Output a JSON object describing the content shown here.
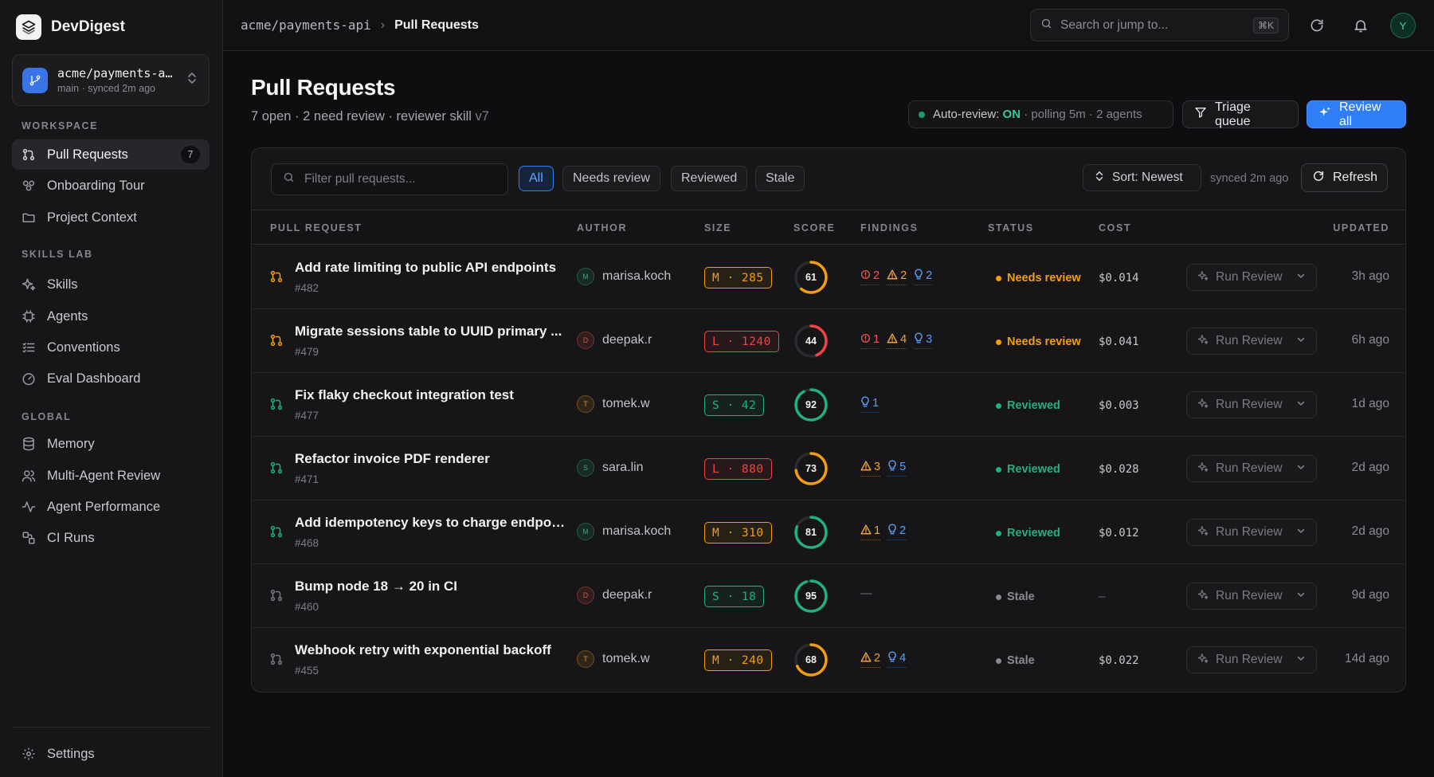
{
  "brand": {
    "name": "DevDigest"
  },
  "repo_selector": {
    "name": "acme/payments-a…",
    "sub": "main · synced 2m ago"
  },
  "sidebar": {
    "sections": [
      {
        "label": "WORKSPACE"
      },
      {
        "label": "SKILLS LAB"
      },
      {
        "label": "GLOBAL"
      }
    ],
    "items": [
      {
        "label": "Pull Requests",
        "icon": "pull-request-icon",
        "badge": "7",
        "active": true
      },
      {
        "label": "Onboarding Tour",
        "icon": "tour-icon"
      },
      {
        "label": "Project Context",
        "icon": "folder-icon"
      },
      {
        "label": "Skills",
        "icon": "sparkle-icon"
      },
      {
        "label": "Agents",
        "icon": "cpu-icon"
      },
      {
        "label": "Conventions",
        "icon": "list-check-icon"
      },
      {
        "label": "Eval Dashboard",
        "icon": "gauge-icon"
      },
      {
        "label": "Memory",
        "icon": "database-icon"
      },
      {
        "label": "Multi-Agent Review",
        "icon": "users-icon"
      },
      {
        "label": "Agent Performance",
        "icon": "activity-icon"
      },
      {
        "label": "CI Runs",
        "icon": "ci-icon"
      }
    ],
    "settings_label": "Settings"
  },
  "topbar": {
    "breadcrumb_repo": "acme/payments-api",
    "breadcrumb_sep": "›",
    "breadcrumb_current": "Pull Requests",
    "search_placeholder": "Search or jump to...",
    "search_shortcut": "⌘K",
    "avatar_initial": "Y"
  },
  "header": {
    "title": "Pull Requests",
    "subtitle": "7 open · 2 need review · reviewer skill ",
    "subtitle_version": "v7",
    "auto_review_label": "Auto-review: ",
    "auto_review_state": "ON",
    "auto_review_detail": " · polling 5m · 2 agents",
    "triage_label": "Triage queue",
    "review_all_label": "Review all"
  },
  "filters": {
    "placeholder": "Filter pull requests...",
    "chips": [
      "All",
      "Needs review",
      "Reviewed",
      "Stale"
    ],
    "active_chip": "All",
    "sort_label": "Sort: Newest",
    "synced": "synced 2m ago",
    "refresh_label": "Refresh"
  },
  "columns": [
    "PULL REQUEST",
    "AUTHOR",
    "SIZE",
    "SCORE",
    "FINDINGS",
    "STATUS",
    "COST",
    "UPDATED"
  ],
  "run_review_label": "Run Review",
  "colors": {
    "green": "#22b07d",
    "amber": "#f59e0b",
    "red": "#ef4444",
    "blue": "#5b9df6",
    "gray": "#8a8a92",
    "accent": "#2f7ef7"
  },
  "rows": [
    {
      "title": "Add rate limiting to public API endpoints",
      "number": "#482",
      "author": "marisa.koch",
      "author_initial": "M",
      "size": "M · 285",
      "size_level": "M",
      "score": 61,
      "findings": {
        "errors": "2",
        "warnings": "2",
        "suggestions": "2"
      },
      "status": "Needs review",
      "cost": "$0.014",
      "updated": "3h ago"
    },
    {
      "title": "Migrate sessions table to UUID primary ...",
      "number": "#479",
      "author": "deepak.r",
      "author_initial": "D",
      "size": "L · 1240",
      "size_level": "L",
      "score": 44,
      "findings": {
        "errors": "1",
        "warnings": "4",
        "suggestions": "3"
      },
      "status": "Needs review",
      "cost": "$0.041",
      "updated": "6h ago"
    },
    {
      "title": "Fix flaky checkout integration test",
      "number": "#477",
      "author": "tomek.w",
      "author_initial": "T",
      "size": "S · 42",
      "size_level": "S",
      "score": 92,
      "findings": {
        "suggestions": "1"
      },
      "status": "Reviewed",
      "cost": "$0.003",
      "updated": "1d ago"
    },
    {
      "title": "Refactor invoice PDF renderer",
      "number": "#471",
      "author": "sara.lin",
      "author_initial": "S",
      "size": "L · 880",
      "size_level": "L",
      "score": 73,
      "findings": {
        "warnings": "3",
        "suggestions": "5"
      },
      "status": "Reviewed",
      "cost": "$0.028",
      "updated": "2d ago"
    },
    {
      "title": "Add idempotency keys to charge endpoint",
      "number": "#468",
      "author": "marisa.koch",
      "author_initial": "M",
      "size": "M · 310",
      "size_level": "M",
      "score": 81,
      "findings": {
        "warnings": "1",
        "suggestions": "2"
      },
      "status": "Reviewed",
      "cost": "$0.012",
      "updated": "2d ago"
    },
    {
      "title": "Bump node 18 → 20 in CI",
      "number": "#460",
      "author": "deepak.r",
      "author_initial": "D",
      "size": "S · 18",
      "size_level": "S",
      "score": 95,
      "findings": {},
      "findings_empty": "—",
      "status": "Stale",
      "cost": "—",
      "updated": "9d ago"
    },
    {
      "title": "Webhook retry with exponential backoff",
      "number": "#455",
      "author": "tomek.w",
      "author_initial": "T",
      "size": "M · 240",
      "size_level": "M",
      "score": 68,
      "findings": {
        "warnings": "2",
        "suggestions": "4"
      },
      "status": "Stale",
      "cost": "$0.022",
      "updated": "14d ago"
    }
  ]
}
